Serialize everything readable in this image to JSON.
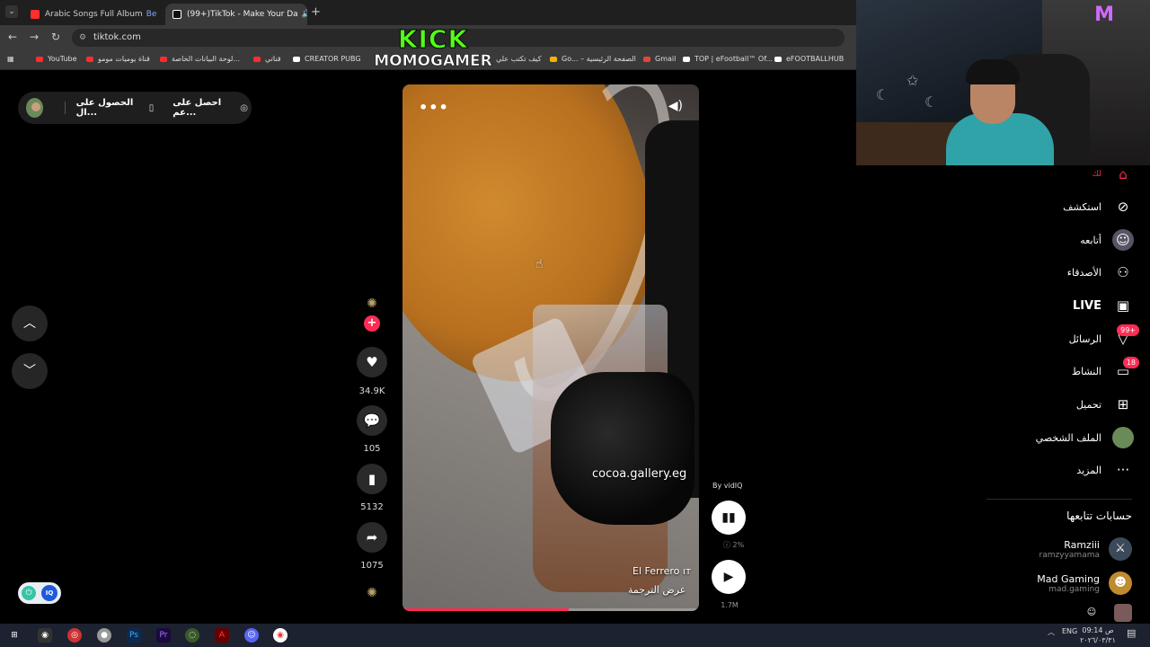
{
  "browser": {
    "tabs": [
      {
        "title": "Arabic Songs Full Album",
        "favicon_color": "#ff2e2e",
        "extra": "Be"
      },
      {
        "title": "(99+)TikTok - Make Your Da",
        "favicon_color": "#ffffff",
        "active": true
      }
    ],
    "url": "tiktok.com",
    "bookmarks": [
      {
        "label": "YouTube",
        "color": "#ff2e2e"
      },
      {
        "label": "قناة يوميات مومو",
        "color": "#ff2e2e"
      },
      {
        "label": "لوحة البيانات الخاصة...",
        "color": "#ff2e2e"
      },
      {
        "label": "قناتي",
        "color": "#ff2e2e"
      },
      {
        "label": "CREATOR PUBG",
        "color": "#ffffff"
      },
      {
        "label": "كيف تكتب علي",
        "color": "#6a3cff"
      },
      {
        "label": "Go... – الصفحة الرئيسية",
        "color": "#f4b400"
      },
      {
        "label": "Gmail",
        "color": "#ea4335"
      },
      {
        "label": "TOP | eFootball™ Of...",
        "color": "#ffffff"
      },
      {
        "label": "eFOOTBALLHUB",
        "color": "#ffffff"
      }
    ]
  },
  "overlay": {
    "kick": "KICK",
    "name": "MOMOGAMER"
  },
  "promo": {
    "item1": "احصل على عم...",
    "item2": "الحصول على ال..."
  },
  "video": {
    "handle": "cocoa.gallery.eg",
    "music": "El Ferrero ıт",
    "translate": "عرض الترجمة",
    "progress": 0.56
  },
  "actions": {
    "likes": "34.9K",
    "comments": "105",
    "saves": "5132",
    "shares": "1075"
  },
  "vidiq": {
    "by": "By vidIQ",
    "pct": "2%",
    "views": "1.7M"
  },
  "nav": {
    "home": "لك",
    "explore": "استكشف",
    "following": "أتابعه",
    "friends": "الأصدقاء",
    "live": "LIVE",
    "messages": "الرسائل",
    "messages_badge": "99+",
    "activity": "النشاط",
    "activity_badge": "18",
    "upload": "تحميل",
    "profile": "الملف الشخصي",
    "more": "المزيد"
  },
  "following_section": {
    "title": "حسابات تتابعها",
    "accounts": [
      {
        "name": "Ramziii",
        "handle": "ramzyyamama"
      },
      {
        "name": "Mad Gaming",
        "handle": "mad.gaming"
      }
    ]
  },
  "taskbar": {
    "lang": "ENG",
    "time": "09:14 ص",
    "date": "٢٠٢٦/٠٣/٣١"
  }
}
